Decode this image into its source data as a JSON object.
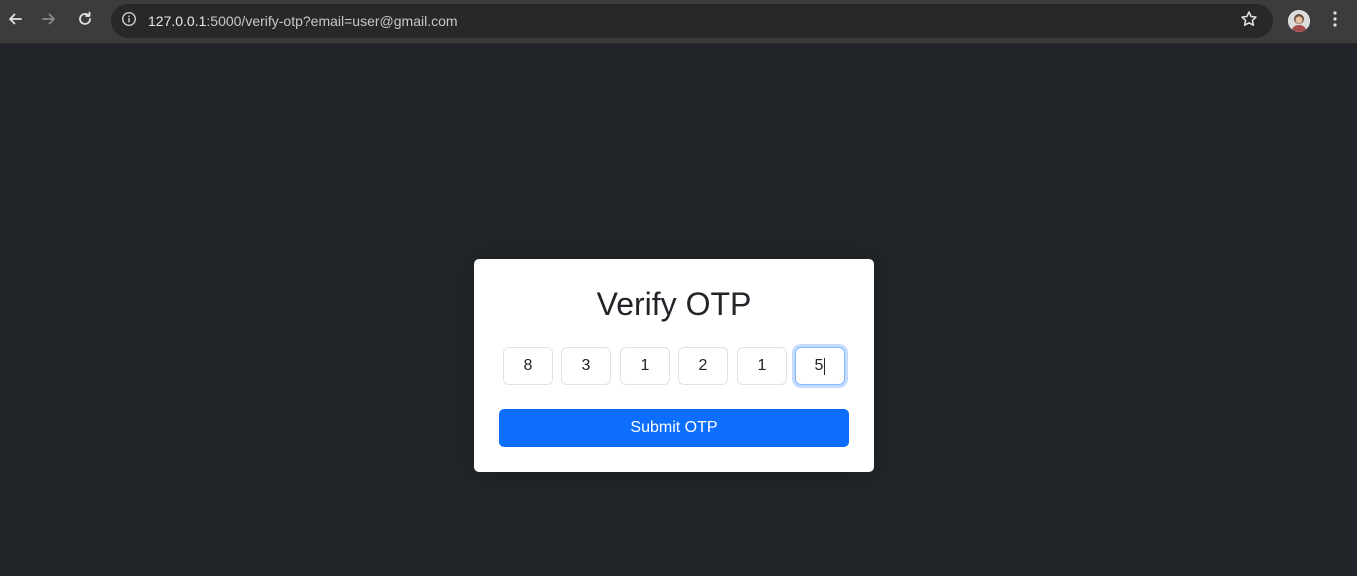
{
  "browser": {
    "url_host": "127.0.0.1",
    "url_rest": ":5000/verify-otp?email=user@gmail.com",
    "icons": {
      "back": "back-arrow-icon",
      "forward": "forward-arrow-icon",
      "reload": "reload-icon",
      "site_info": "info-icon",
      "bookmark": "star-icon",
      "profile": "avatar",
      "menu": "kebab-menu-icon"
    }
  },
  "page": {
    "title": "Verify OTP",
    "otp_digits": [
      "8",
      "3",
      "1",
      "2",
      "1",
      "5"
    ],
    "focused_index": 5,
    "submit_label": "Submit OTP",
    "colors": {
      "background": "#212529",
      "primary": "#0d6efd",
      "card": "#ffffff"
    }
  }
}
